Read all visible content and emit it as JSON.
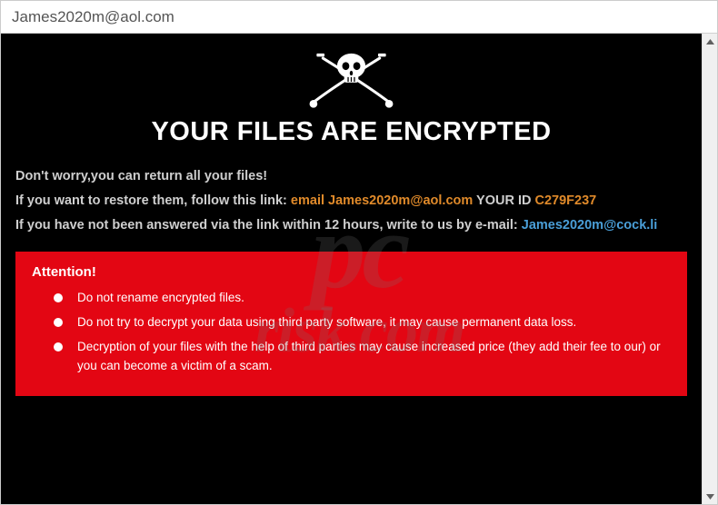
{
  "window": {
    "title": "James2020m@aol.com"
  },
  "headline": "YOUR FILES ARE ENCRYPTED",
  "lines": {
    "l1": "Don't worry,you can return all your files!",
    "l2_prefix": "If you want to restore them, follow this link: ",
    "l2_email_label": "email James2020m@aol.com",
    "l2_id_label": "  YOUR ID ",
    "l2_id": "C279F237",
    "l3_prefix": "If you have not been answered via the link within 12 hours, write to us by e-mail: ",
    "l3_email": "James2020m@cock.li"
  },
  "attention": {
    "title": "Attention!",
    "items": [
      "Do not rename encrypted files.",
      "Do not try to decrypt your data using third party software, it may cause permanent data loss.",
      "Decryption of your files with the help of third parties may cause increased price (they add their fee to our) or you can become a victim of a scam."
    ]
  },
  "watermark": {
    "main": "pc",
    "sub": "risk.com"
  }
}
